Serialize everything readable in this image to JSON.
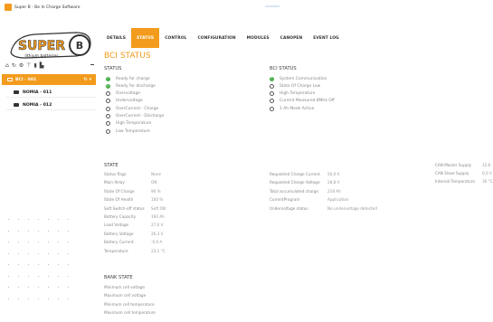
{
  "window": {
    "title": "Super B - Be In Charge Software"
  },
  "logo": {
    "brand": "SUPER B",
    "tagline": "lithium batteries"
  },
  "sidebar": {
    "active_group": "BCI - 001",
    "nodes": [
      "NOMIA - 011",
      "NOMIA - 012"
    ]
  },
  "tabs": [
    "DETAILS",
    "STATUS",
    "CONTROL",
    "CONFIGURATION",
    "MODULES",
    "CANOPEN",
    "EVENT LOG"
  ],
  "active_tab": "STATUS",
  "page_title": "BCI STATUS",
  "status": {
    "heading": "STATUS",
    "items": [
      {
        "label": "Ready for charge",
        "on": true
      },
      {
        "label": "Ready for discharge",
        "on": true
      },
      {
        "label": "Overvoltage",
        "on": false
      },
      {
        "label": "Undervoltage",
        "on": false
      },
      {
        "label": "OverCurrent - Charge",
        "on": false
      },
      {
        "label": "OverCurrent - Discharge",
        "on": false
      },
      {
        "label": "High Temperature",
        "on": false
      },
      {
        "label": "Low Temperature",
        "on": false
      }
    ]
  },
  "bci_status": {
    "heading": "BCI STATUS",
    "items": [
      {
        "label": "System Communication",
        "on": true
      },
      {
        "label": "State Of Charge Low",
        "on": false
      },
      {
        "label": "High Temperature",
        "on": false
      },
      {
        "label": "Current Measured 8MHz Off",
        "on": false
      },
      {
        "label": "1 Ah Mode Active",
        "on": false
      }
    ]
  },
  "state": {
    "heading": "STATE",
    "col1": [
      {
        "label": "Status flags",
        "value": "None"
      },
      {
        "label": "Main Relay",
        "value": "ON"
      },
      {
        "label": "State Of Charge",
        "value": "90 %"
      },
      {
        "label": "State Of Health",
        "value": "100 %"
      },
      {
        "label": "Soft Switch-off status",
        "value": "Soft ON"
      },
      {
        "label": "Battery Capacity",
        "value": "160 Ah"
      },
      {
        "label": "Load Voltage",
        "value": "27,0 V"
      },
      {
        "label": "Battery Voltage",
        "value": "26,3 V"
      },
      {
        "label": "Battery Current",
        "value": "-0,0 A"
      },
      {
        "label": "Temperature",
        "value": "23,1 °C"
      }
    ],
    "col2": [
      {
        "label": "Requested Charge Current",
        "value": "50,0 A"
      },
      {
        "label": "Requested Charge Voltage",
        "value": "28,8 V"
      },
      {
        "label": "Total accumulated charge",
        "value": "218 Ah"
      },
      {
        "label": "CurrentProgram",
        "value": "Application"
      },
      {
        "label": "Undervoltage status",
        "value": "No undervoltage detected"
      }
    ],
    "col3": [
      {
        "label": "CAN Master Supply",
        "value": "12,6"
      },
      {
        "label": "CAN Slave Supply",
        "value": "0,0 V"
      },
      {
        "label": "Internal Temperature",
        "value": "30 °C"
      }
    ]
  },
  "bank_state": {
    "heading": "BANK STATE",
    "rows": [
      "Minimum cell voltage",
      "Maximum cell voltage",
      "Minimum cell temperature",
      "Maximum cell temperature"
    ]
  },
  "colors": {
    "accent": "#f39b1c",
    "ok": "#4caf50"
  },
  "icons": [
    "home-icon",
    "refresh-icon",
    "settings-icon",
    "network-icon",
    "battery-icon",
    "chart-icon"
  ]
}
